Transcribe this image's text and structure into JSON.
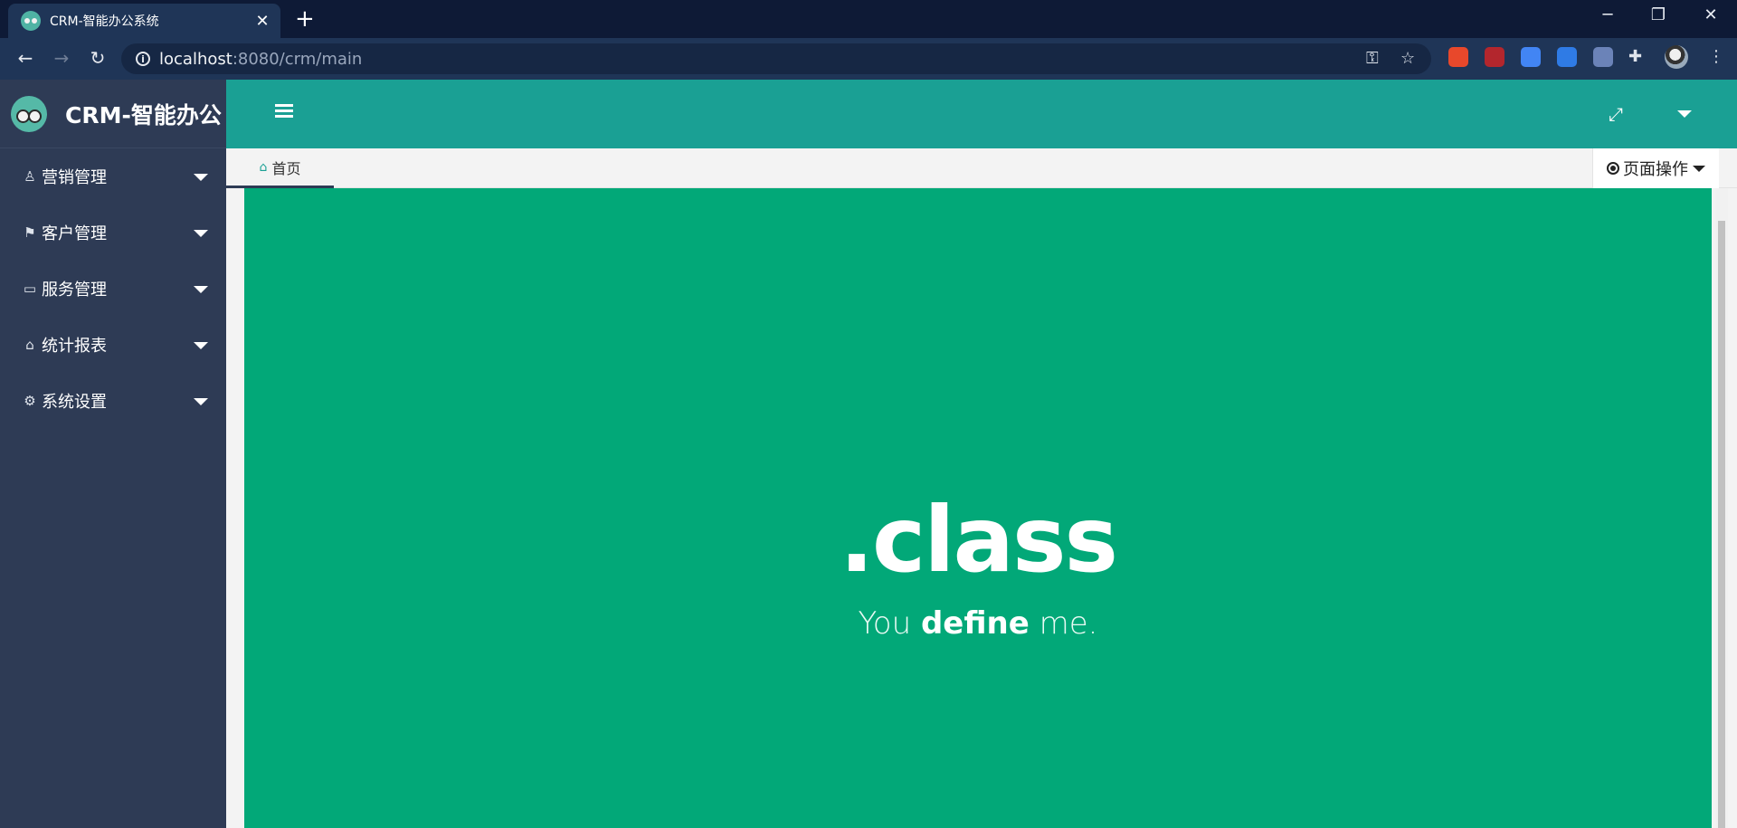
{
  "browser": {
    "tab_title": "CRM-智能办公系统",
    "tab_close": "✕",
    "new_tab": "+",
    "url_host": "localhost",
    "url_path": ":8080/crm/main",
    "controls": {
      "minimize": "─",
      "restore": "❐",
      "close": "✕"
    },
    "extensions": [
      {
        "name": "color-grid-extension",
        "color": "#e8482b"
      },
      {
        "name": "pdf-extension",
        "color": "#b3262d"
      },
      {
        "name": "drive-extension",
        "color": "#4285f4"
      },
      {
        "name": "blue-extension",
        "color": "#2f7be5"
      },
      {
        "name": "ring-extension",
        "color": "#6b83b8"
      }
    ]
  },
  "brand": {
    "name": "CRM-智能办公"
  },
  "sidebar": {
    "items": [
      {
        "label": "营销管理",
        "icon": "person-icon",
        "glyph": "♙"
      },
      {
        "label": "客户管理",
        "icon": "flag-icon",
        "glyph": "⚑"
      },
      {
        "label": "服务管理",
        "icon": "monitor-icon",
        "glyph": "▭"
      },
      {
        "label": "统计报表",
        "icon": "home-icon",
        "glyph": "⌂"
      },
      {
        "label": "系统设置",
        "icon": "gears-icon",
        "glyph": "⚙"
      }
    ]
  },
  "tabs": {
    "home_label": "首页",
    "page_ops_label": "页面操作"
  },
  "content": {
    "hero_title": ".class",
    "tagline_pre": "You ",
    "tagline_bold": "define",
    "tagline_post": " me."
  },
  "colors": {
    "accent": "#1aa094",
    "sidebar": "#2e3b55",
    "content_bg": "#02a878"
  }
}
